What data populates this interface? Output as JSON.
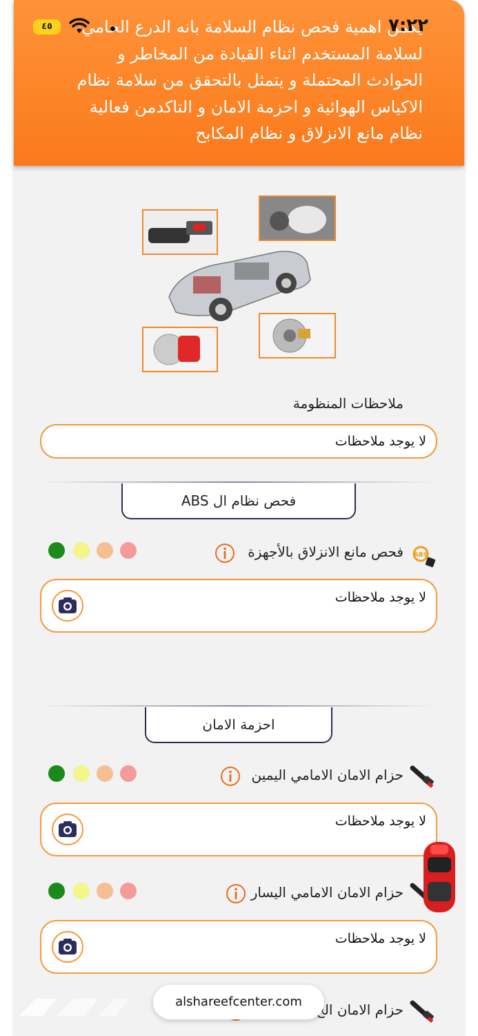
{
  "status_bar": {
    "time": "٧:٢٢",
    "battery": "٤٥"
  },
  "hero": {
    "lines": [
      "يكمن اهمية فحص نظام السلامة بانه الدرع الحامي",
      "لسلامة المستخدم اثناء القيادة من المخاطر و",
      "الحوادث المحتملة و يتمثل بالتحقق من سلامة نظام",
      "الاكياس الهوائية و احزمة الامان و التاكدمن فعالية",
      "نظام مانع الانزلاق و نظام المكابح"
    ]
  },
  "system_notes": {
    "label": "ملاحظات المنظومة",
    "value": "لا يوجد ملاحظات"
  },
  "sections": [
    {
      "title": "فحص نظام ال ABS",
      "items": [
        {
          "label": "فحص مانع الانزلاق بالأجهزة",
          "note": "لا يوجد ملاحظات",
          "icon": "abs-warning-icon"
        }
      ]
    },
    {
      "title": "احزمة الامان",
      "items": [
        {
          "label": "حزام الامان الامامي اليمين",
          "note": "لا يوجد ملاحظات",
          "icon": "seatbelt-icon"
        },
        {
          "label": "حزام الامان الامامي اليسار",
          "note": "لا يوجد ملاحظات",
          "icon": "seatbelt-icon"
        },
        {
          "label": "حزام الامان الخ",
          "note": "",
          "icon": "seatbelt-icon"
        }
      ]
    }
  ],
  "status_colors": {
    "red": "#f59a9a",
    "orange": "#f5bf94",
    "yellow": "#f5f58a",
    "green": "#1a8a1a"
  },
  "accent": "#f59a3c",
  "url": "alshareefcenter.com"
}
